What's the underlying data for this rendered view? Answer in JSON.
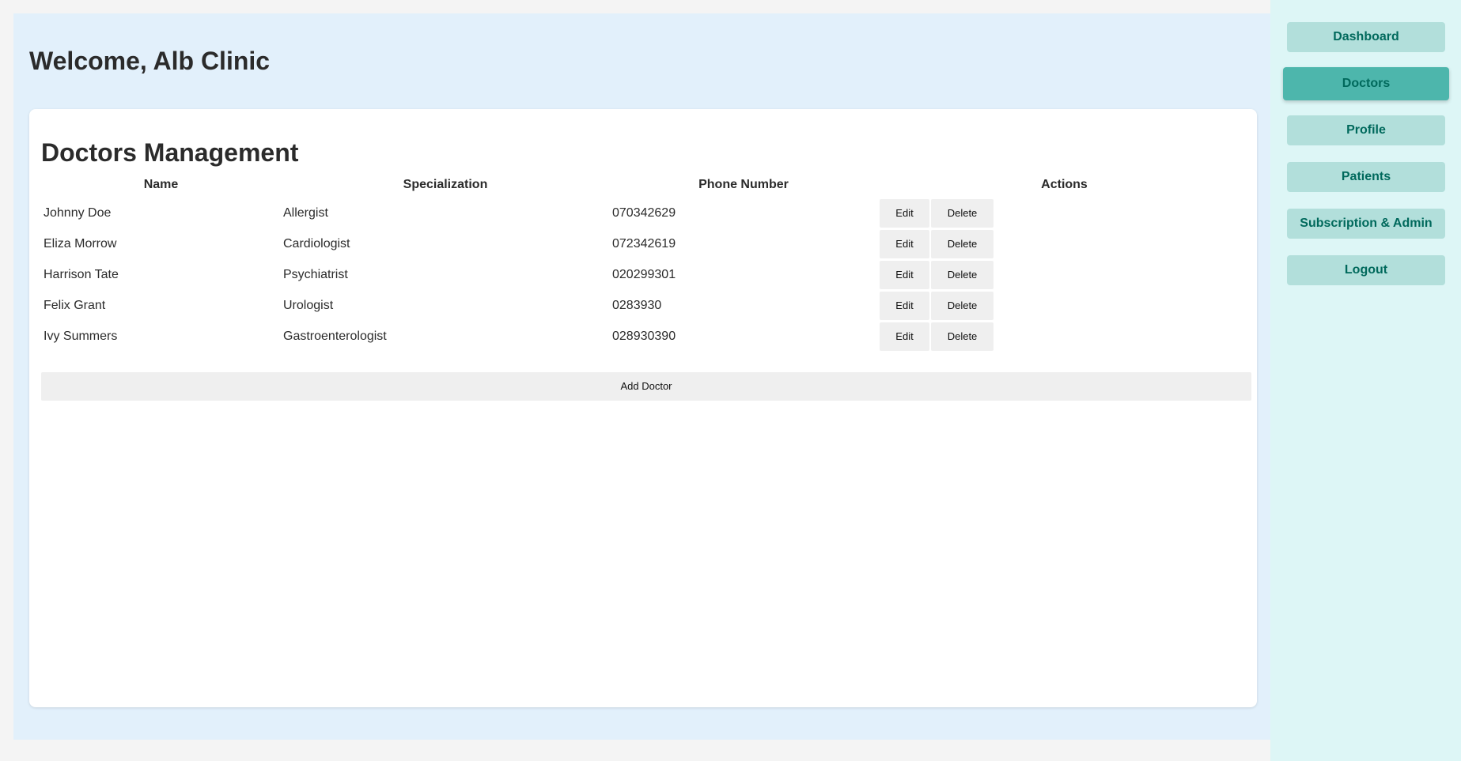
{
  "header": {
    "welcome": "Welcome, Alb Clinic"
  },
  "doctors": {
    "title": "Doctors Management",
    "columns": {
      "name": "Name",
      "specialization": "Specialization",
      "phone": "Phone Number",
      "actions": "Actions"
    },
    "rows": [
      {
        "name": "Johnny Doe",
        "specialization": "Allergist",
        "phone": "070342629"
      },
      {
        "name": "Eliza Morrow",
        "specialization": "Cardiologist",
        "phone": "072342619"
      },
      {
        "name": "Harrison Tate",
        "specialization": "Psychiatrist",
        "phone": "020299301"
      },
      {
        "name": "Felix Grant",
        "specialization": "Urologist",
        "phone": "0283930"
      },
      {
        "name": "Ivy Summers",
        "specialization": "Gastroenterologist",
        "phone": "028930390"
      }
    ],
    "edit_label": "Edit",
    "delete_label": "Delete",
    "add_label": "Add Doctor"
  },
  "sidebar": {
    "items": [
      {
        "label": "Dashboard",
        "active": false
      },
      {
        "label": "Doctors",
        "active": true
      },
      {
        "label": "Profile",
        "active": false
      },
      {
        "label": "Patients",
        "active": false
      },
      {
        "label": "Subscription & Admin",
        "active": false
      },
      {
        "label": "Logout",
        "active": false
      }
    ]
  },
  "colors": {
    "page_bg": "#f4f4f4",
    "main_bg": "#e2f0fb",
    "sidebar_bg": "#ddf6f6",
    "nav_bg": "#b2dfdb",
    "nav_active_bg": "#4db6ac",
    "nav_text": "#00695c"
  }
}
